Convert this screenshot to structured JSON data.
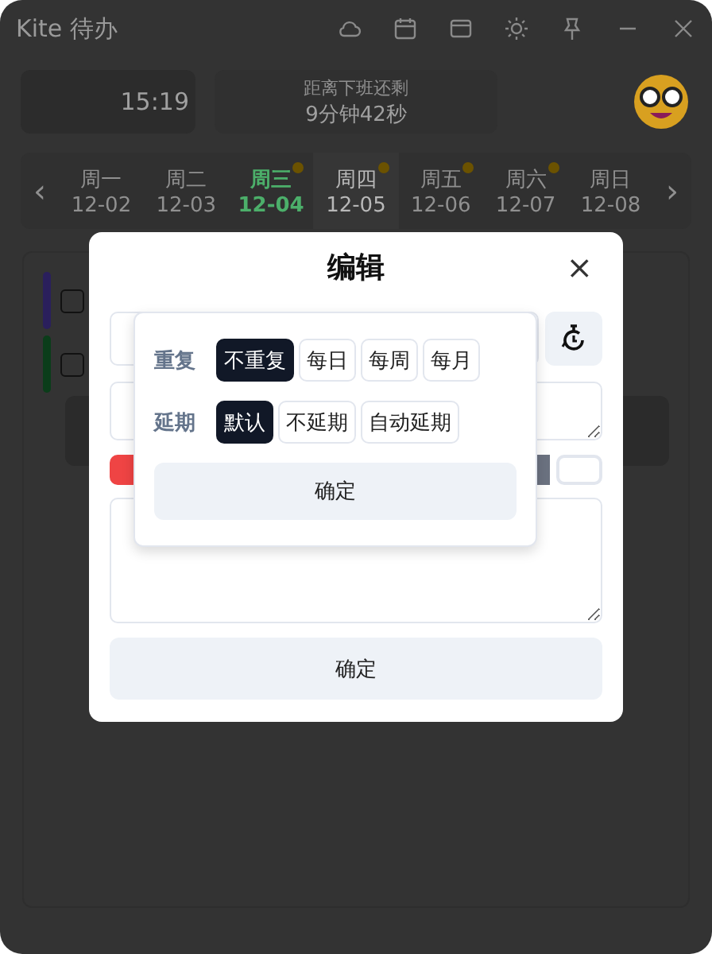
{
  "window": {
    "title": "Kite 待办"
  },
  "clock": {
    "time": "15:19"
  },
  "countdown": {
    "label": "距离下班还剩",
    "value": "9分钟42秒"
  },
  "week": {
    "prev": "‹",
    "next": "›",
    "days": [
      {
        "day": "周一",
        "date": "12-02",
        "selected": false,
        "highlighted": false,
        "has_dot": false
      },
      {
        "day": "周二",
        "date": "12-03",
        "selected": false,
        "highlighted": false,
        "has_dot": false
      },
      {
        "day": "周三",
        "date": "12-04",
        "selected": true,
        "highlighted": false,
        "has_dot": true
      },
      {
        "day": "周四",
        "date": "12-05",
        "selected": false,
        "highlighted": true,
        "has_dot": true
      },
      {
        "day": "周五",
        "date": "12-06",
        "selected": false,
        "highlighted": false,
        "has_dot": true
      },
      {
        "day": "周六",
        "date": "12-07",
        "selected": false,
        "highlighted": false,
        "has_dot": true
      },
      {
        "day": "周日",
        "date": "12-08",
        "selected": false,
        "highlighted": false,
        "has_dot": false
      }
    ]
  },
  "tasks": [
    {
      "color": "#2a1f5c",
      "checked": false
    },
    {
      "color": "#0b3d1a",
      "checked": false
    }
  ],
  "dialog": {
    "title": "编辑",
    "close": "×",
    "swatches": [
      {
        "color": "#ef4444"
      },
      {
        "color": "#6b7280"
      },
      {
        "color": "#ffffff"
      }
    ],
    "confirm": "确定",
    "popover": {
      "repeat": {
        "label": "重复",
        "options": [
          {
            "label": "不重复",
            "selected": true
          },
          {
            "label": "每日",
            "selected": false
          },
          {
            "label": "每周",
            "selected": false
          },
          {
            "label": "每月",
            "selected": false
          }
        ]
      },
      "delay": {
        "label": "延期",
        "options": [
          {
            "label": "默认",
            "selected": true
          },
          {
            "label": "不延期",
            "selected": false
          },
          {
            "label": "自动延期",
            "selected": false
          }
        ]
      },
      "confirm": "确定"
    }
  }
}
